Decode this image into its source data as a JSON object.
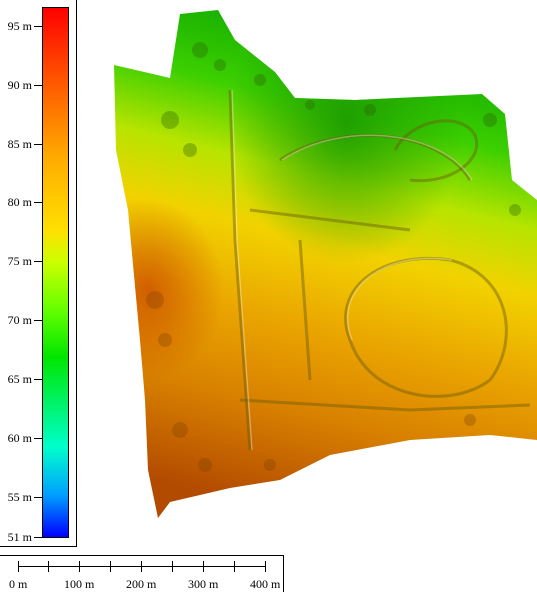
{
  "legend": {
    "ticks": [
      "95 m",
      "90 m",
      "85 m",
      "80 m",
      "75 m",
      "70 m",
      "65 m",
      "60 m",
      "55 m",
      "51 m"
    ],
    "gradient": [
      "#ff0000",
      "#ff6a00",
      "#ffaa00",
      "#ffe000",
      "#ccff00",
      "#66ff00",
      "#00e600",
      "#00ffcc",
      "#00a0ff",
      "#0000ff"
    ]
  },
  "scale": {
    "labels": [
      "0 m",
      "100 m",
      "200 m",
      "300 m",
      "400 m"
    ]
  }
}
